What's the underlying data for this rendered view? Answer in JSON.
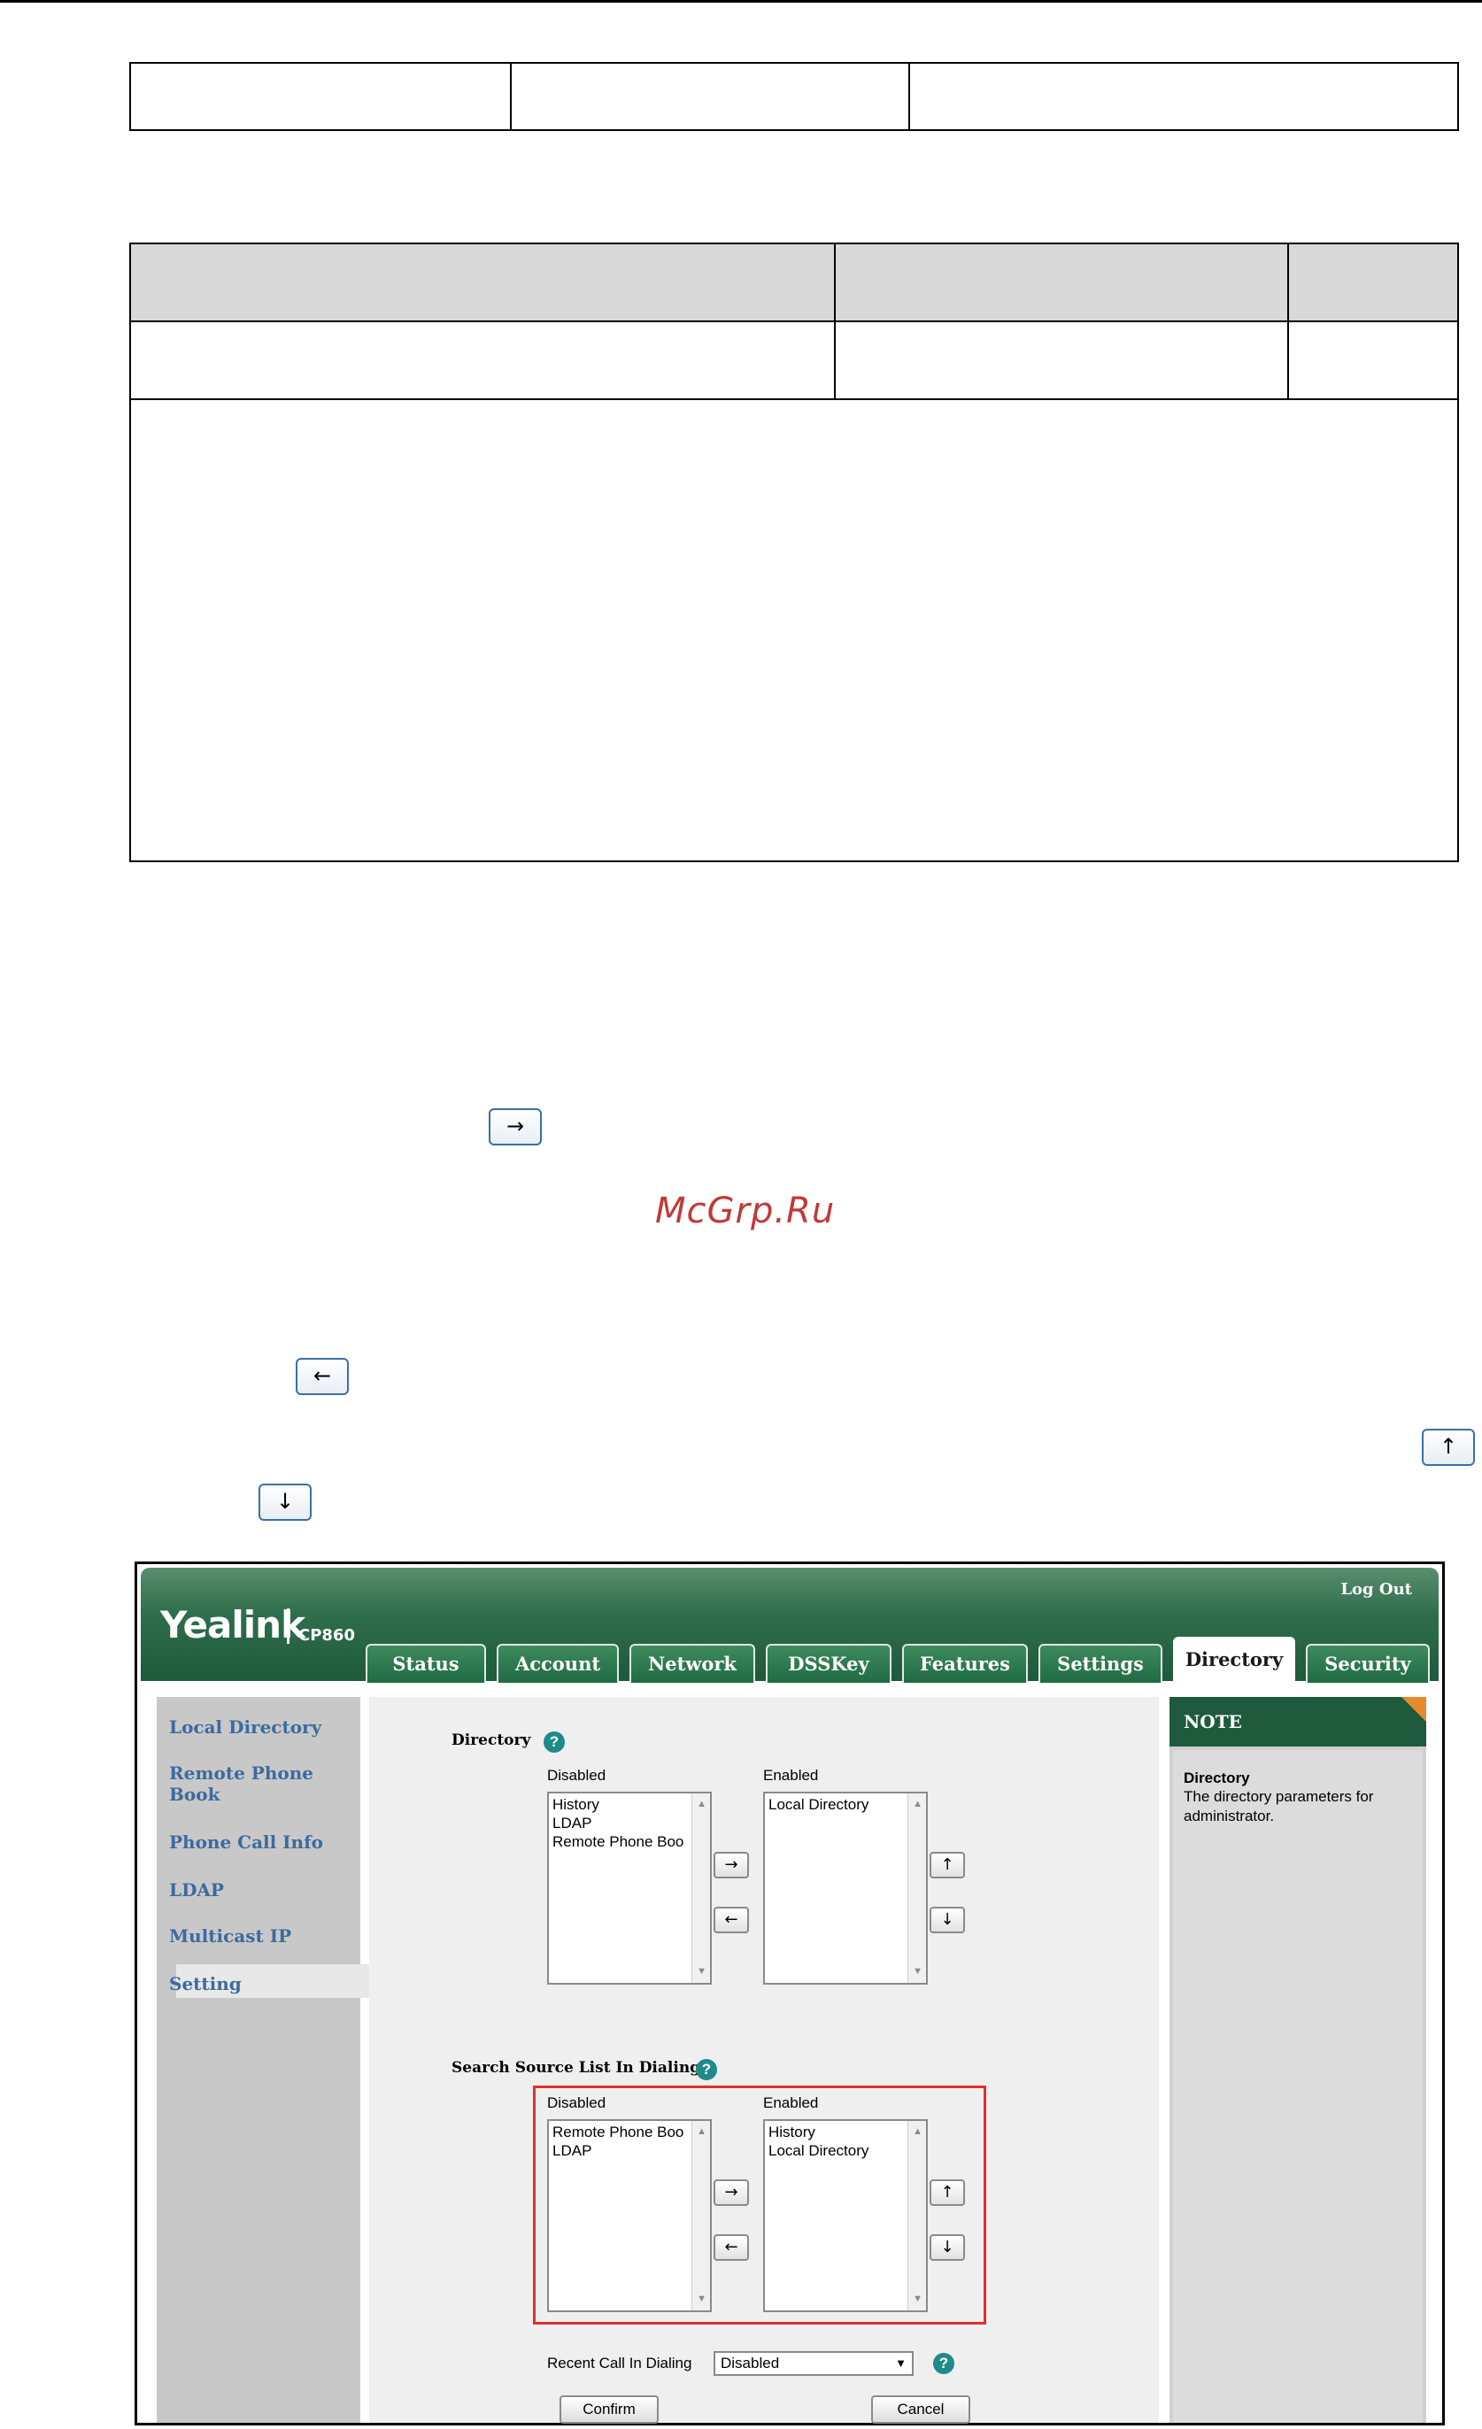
{
  "watermark": "McGrp.Ru",
  "key_icons": {
    "right": "→",
    "left": "←",
    "up": "↑",
    "down": "↓"
  },
  "ui": {
    "brand": "Yealink",
    "model": "CP860",
    "logout": "Log Out",
    "tabs": [
      "Status",
      "Account",
      "Network",
      "DSSKey",
      "Features",
      "Settings",
      "Directory",
      "Security"
    ],
    "active_tab": "Directory",
    "sidebar": [
      "Local Directory",
      "Remote Phone Book",
      "Phone Call Info",
      "LDAP",
      "Multicast IP",
      "Setting"
    ],
    "active_sidebar": "Setting",
    "note": {
      "header": "NOTE",
      "title": "Directory",
      "text": "The directory parameters for administrator."
    },
    "directory": {
      "title": "Directory",
      "disabled_label": "Disabled",
      "enabled_label": "Enabled",
      "disabled_items": [
        "History",
        "LDAP",
        "Remote Phone Boo"
      ],
      "enabled_items": [
        "Local Directory"
      ]
    },
    "search_source": {
      "title": "Search Source List In Dialing",
      "disabled_label": "Disabled",
      "enabled_label": "Enabled",
      "disabled_items": [
        "Remote Phone Boo",
        "LDAP"
      ],
      "enabled_items": [
        "History",
        "Local Directory"
      ]
    },
    "recent_call": {
      "label": "Recent Call In Dialing",
      "value": "Disabled"
    },
    "buttons": {
      "confirm": "Confirm",
      "cancel": "Cancel"
    },
    "arrows": {
      "right": "→",
      "left": "←",
      "up": "↑",
      "down": "↓"
    },
    "colors": {
      "header_green": "#1e5a3b",
      "sidebar_text": "#3c6aa0",
      "highlight_red": "#e0302f"
    }
  }
}
